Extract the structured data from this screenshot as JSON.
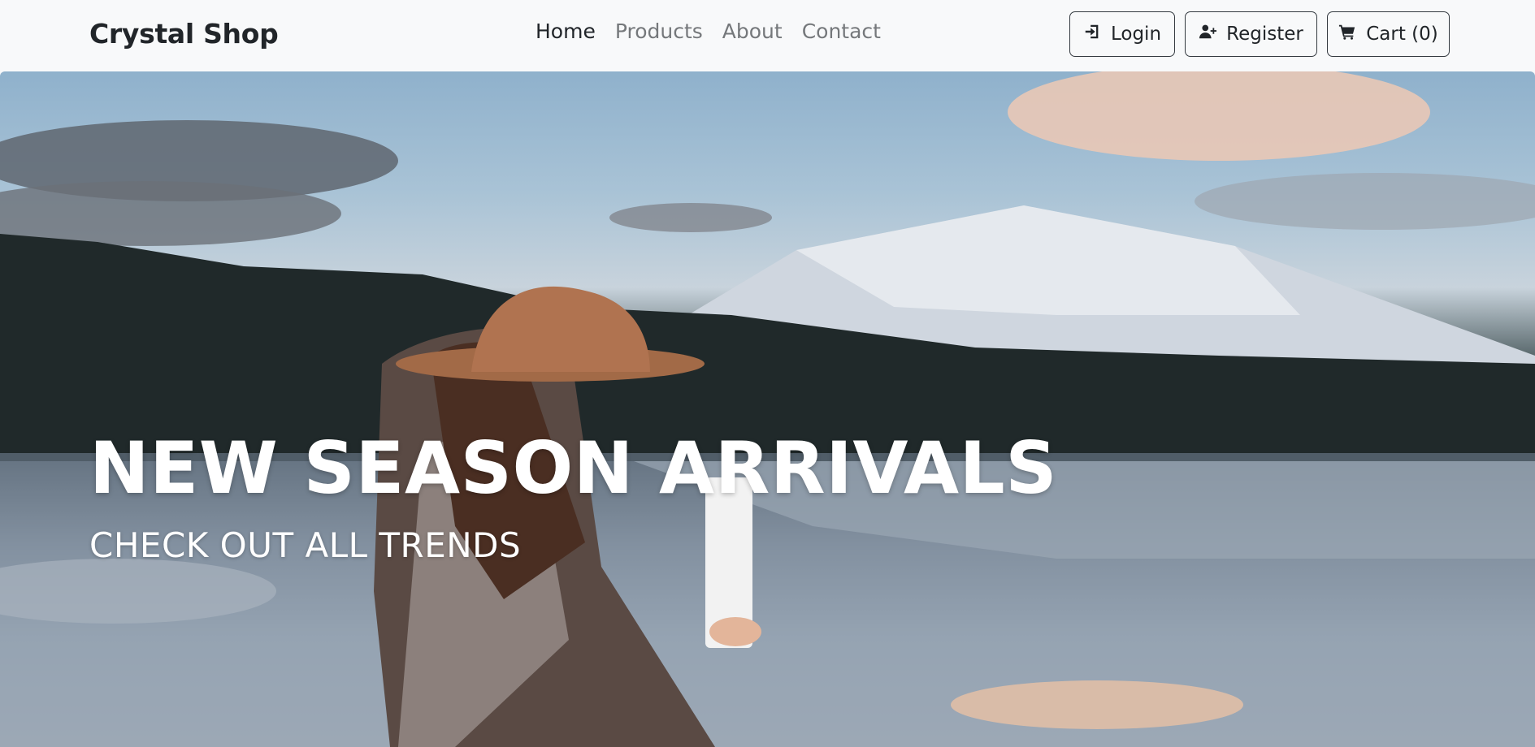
{
  "navbar": {
    "brand": "Crystal Shop",
    "links": [
      {
        "label": "Home",
        "active": true
      },
      {
        "label": "Products",
        "active": false
      },
      {
        "label": "About",
        "active": false
      },
      {
        "label": "Contact",
        "active": false
      }
    ],
    "buttons": {
      "login": {
        "label": "Login",
        "icon": "sign-in-icon"
      },
      "register": {
        "label": "Register",
        "icon": "user-plus-icon"
      },
      "cart": {
        "label": "Cart (0)",
        "icon": "cart-icon"
      }
    }
  },
  "hero": {
    "title": "NEW SEASON ARRIVALS",
    "subtitle": "CHECK OUT ALL TRENDS",
    "image": "hero-lake-mountain-photo"
  },
  "colors": {
    "navbar_bg": "#f8f9fa",
    "text_dark": "#212529",
    "nav_muted": "#75787b",
    "hero_text": "#ffffff"
  }
}
